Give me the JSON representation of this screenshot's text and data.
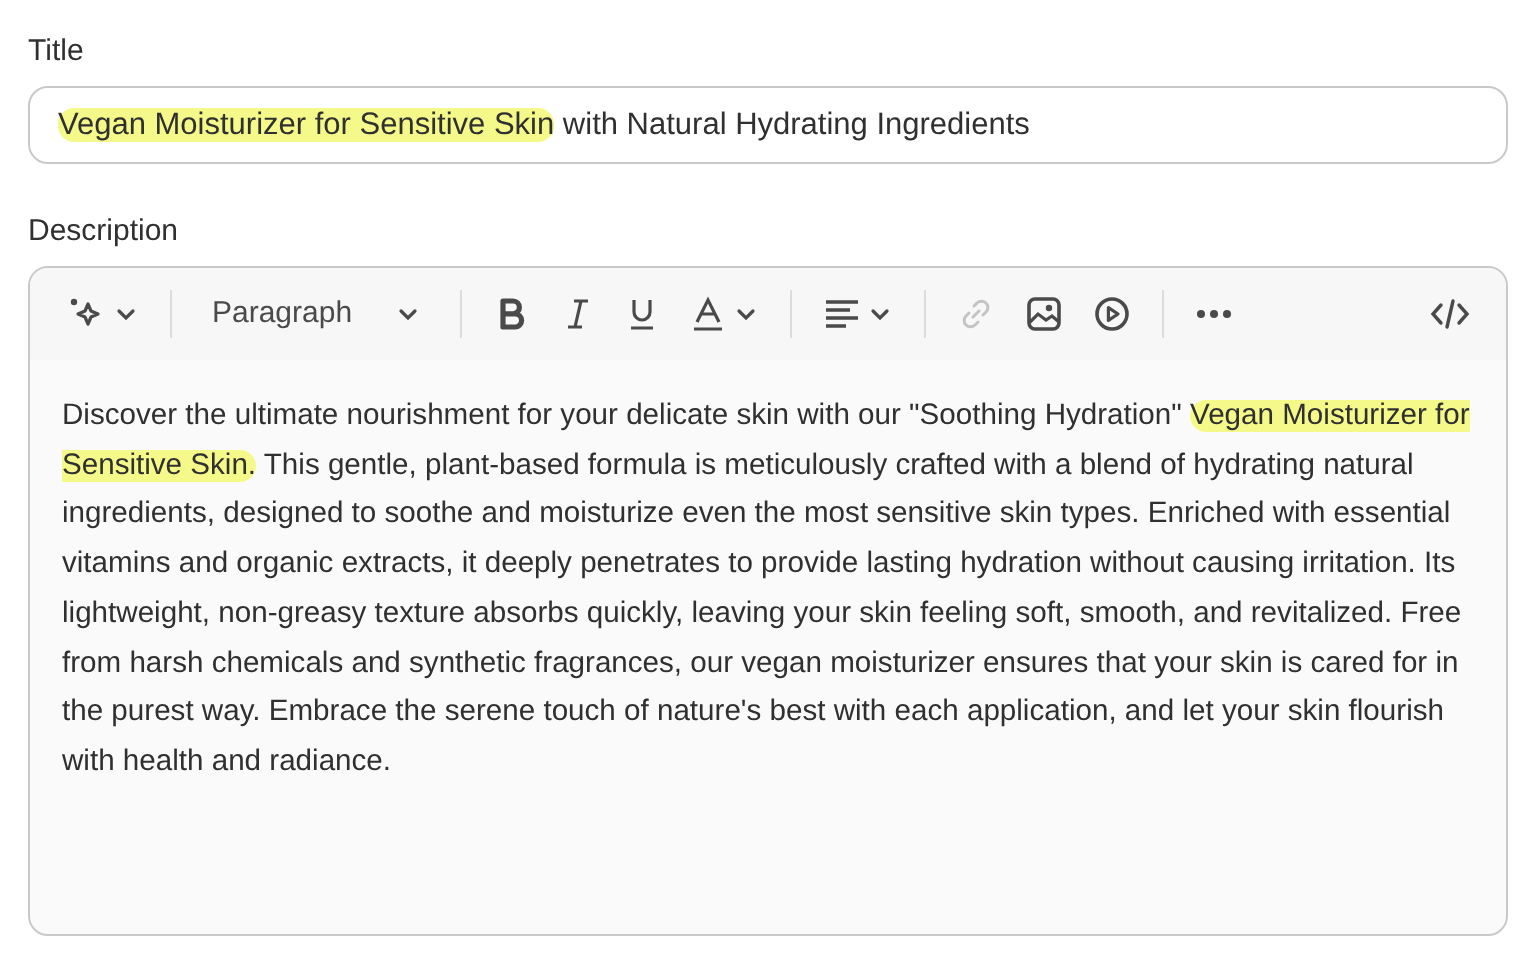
{
  "title_field": {
    "label": "Title",
    "segments": [
      {
        "text": "Vegan Moisturizer for Sensitive Skin",
        "highlighted": true
      },
      {
        "text": " with Natural Hydrating Ingredients",
        "highlighted": false
      }
    ]
  },
  "description": {
    "label": "Description",
    "toolbar": [
      {
        "kind": "ai",
        "disabled": false
      },
      {
        "kind": "separator"
      },
      {
        "kind": "select",
        "text": "Paragraph"
      },
      {
        "kind": "separator"
      },
      {
        "kind": "bold",
        "disabled": false
      },
      {
        "kind": "italic",
        "disabled": false
      },
      {
        "kind": "underline",
        "disabled": false
      },
      {
        "kind": "color",
        "disabled": false
      },
      {
        "kind": "separator"
      },
      {
        "kind": "align",
        "disabled": false
      },
      {
        "kind": "separator"
      },
      {
        "kind": "link",
        "disabled": true
      },
      {
        "kind": "image",
        "disabled": false
      },
      {
        "kind": "video",
        "disabled": false
      },
      {
        "kind": "separator"
      },
      {
        "kind": "more",
        "disabled": false
      },
      {
        "kind": "spacer"
      },
      {
        "kind": "code",
        "disabled": false
      }
    ],
    "segments": [
      {
        "text": "Discover the ultimate nourishment for your delicate skin with our \"Soothing Hydration\" ",
        "highlighted": false
      },
      {
        "text": "Vegan Moisturizer for Sensitive Skin.",
        "highlighted": true
      },
      {
        "text": " This gentle, plant-based formula is meticulously crafted with a blend of hydrating natural ingredients, designed to soothe and moisturize even the most sensitive skin types. Enriched with essential vitamins and organic extracts, it deeply penetrates to provide lasting hydration without causing irritation. Its lightweight, non-greasy texture absorbs quickly, leaving your skin feeling soft, smooth, and revitalized. Free from harsh chemicals and synthetic fragrances, our vegan moisturizer ensures that your skin is cared for in the purest way. Embrace the serene touch of nature's best with each application, and let your skin flourish with health and radiance.",
        "highlighted": false
      }
    ]
  }
}
